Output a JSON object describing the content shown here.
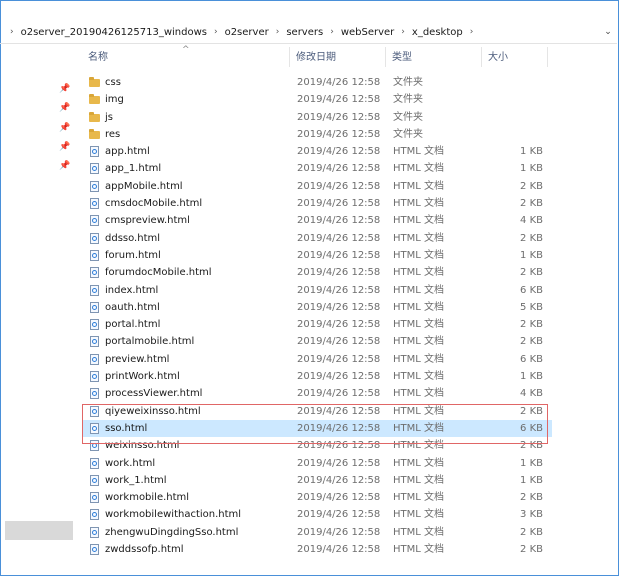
{
  "breadcrumb": {
    "segments": [
      "o2server_20190426125713_windows",
      "o2server",
      "servers",
      "webServer",
      "x_desktop"
    ],
    "dropdown_icon": "chevron-down-icon"
  },
  "columns": {
    "name": "名称",
    "date": "修改日期",
    "type": "类型",
    "size": "大小"
  },
  "files": [
    {
      "name": "css",
      "date": "2019/4/26 12:58",
      "type": "文件夹",
      "size": "",
      "kind": "folder"
    },
    {
      "name": "img",
      "date": "2019/4/26 12:58",
      "type": "文件夹",
      "size": "",
      "kind": "folder"
    },
    {
      "name": "js",
      "date": "2019/4/26 12:58",
      "type": "文件夹",
      "size": "",
      "kind": "folder"
    },
    {
      "name": "res",
      "date": "2019/4/26 12:58",
      "type": "文件夹",
      "size": "",
      "kind": "folder"
    },
    {
      "name": "app.html",
      "date": "2019/4/26 12:58",
      "type": "HTML 文档",
      "size": "1 KB",
      "kind": "html"
    },
    {
      "name": "app_1.html",
      "date": "2019/4/26 12:58",
      "type": "HTML 文档",
      "size": "1 KB",
      "kind": "html"
    },
    {
      "name": "appMobile.html",
      "date": "2019/4/26 12:58",
      "type": "HTML 文档",
      "size": "2 KB",
      "kind": "html"
    },
    {
      "name": "cmsdocMobile.html",
      "date": "2019/4/26 12:58",
      "type": "HTML 文档",
      "size": "2 KB",
      "kind": "html"
    },
    {
      "name": "cmspreview.html",
      "date": "2019/4/26 12:58",
      "type": "HTML 文档",
      "size": "4 KB",
      "kind": "html"
    },
    {
      "name": "ddsso.html",
      "date": "2019/4/26 12:58",
      "type": "HTML 文档",
      "size": "2 KB",
      "kind": "html"
    },
    {
      "name": "forum.html",
      "date": "2019/4/26 12:58",
      "type": "HTML 文档",
      "size": "1 KB",
      "kind": "html"
    },
    {
      "name": "forumdocMobile.html",
      "date": "2019/4/26 12:58",
      "type": "HTML 文档",
      "size": "2 KB",
      "kind": "html"
    },
    {
      "name": "index.html",
      "date": "2019/4/26 12:58",
      "type": "HTML 文档",
      "size": "6 KB",
      "kind": "html"
    },
    {
      "name": "oauth.html",
      "date": "2019/4/26 12:58",
      "type": "HTML 文档",
      "size": "5 KB",
      "kind": "html"
    },
    {
      "name": "portal.html",
      "date": "2019/4/26 12:58",
      "type": "HTML 文档",
      "size": "2 KB",
      "kind": "html"
    },
    {
      "name": "portalmobile.html",
      "date": "2019/4/26 12:58",
      "type": "HTML 文档",
      "size": "2 KB",
      "kind": "html"
    },
    {
      "name": "preview.html",
      "date": "2019/4/26 12:58",
      "type": "HTML 文档",
      "size": "6 KB",
      "kind": "html"
    },
    {
      "name": "printWork.html",
      "date": "2019/4/26 12:58",
      "type": "HTML 文档",
      "size": "1 KB",
      "kind": "html"
    },
    {
      "name": "processViewer.html",
      "date": "2019/4/26 12:58",
      "type": "HTML 文档",
      "size": "4 KB",
      "kind": "html"
    },
    {
      "name": "qiyeweixinsso.html",
      "date": "2019/4/26 12:58",
      "type": "HTML 文档",
      "size": "2 KB",
      "kind": "html"
    },
    {
      "name": "sso.html",
      "date": "2019/4/26 12:58",
      "type": "HTML 文档",
      "size": "6 KB",
      "kind": "html",
      "selected": true
    },
    {
      "name": "weixinsso.html",
      "date": "2019/4/26 12:58",
      "type": "HTML 文档",
      "size": "2 KB",
      "kind": "html"
    },
    {
      "name": "work.html",
      "date": "2019/4/26 12:58",
      "type": "HTML 文档",
      "size": "1 KB",
      "kind": "html"
    },
    {
      "name": "work_1.html",
      "date": "2019/4/26 12:58",
      "type": "HTML 文档",
      "size": "1 KB",
      "kind": "html"
    },
    {
      "name": "workmobile.html",
      "date": "2019/4/26 12:58",
      "type": "HTML 文档",
      "size": "2 KB",
      "kind": "html"
    },
    {
      "name": "workmobilewithaction.html",
      "date": "2019/4/26 12:58",
      "type": "HTML 文档",
      "size": "3 KB",
      "kind": "html"
    },
    {
      "name": "zhengwuDingdingSso.html",
      "date": "2019/4/26 12:58",
      "type": "HTML 文档",
      "size": "2 KB",
      "kind": "html"
    },
    {
      "name": "zwddssofp.html",
      "date": "2019/4/26 12:58",
      "type": "HTML 文档",
      "size": "2 KB",
      "kind": "html"
    }
  ],
  "colors": {
    "selection": "#cce8ff",
    "highlight_border": "#e06666",
    "folder": "#e8b84b"
  },
  "icons": {
    "folder": "folder-icon",
    "html": "html-file-icon",
    "pin": "pin-icon",
    "sort": "sort-up-icon"
  }
}
